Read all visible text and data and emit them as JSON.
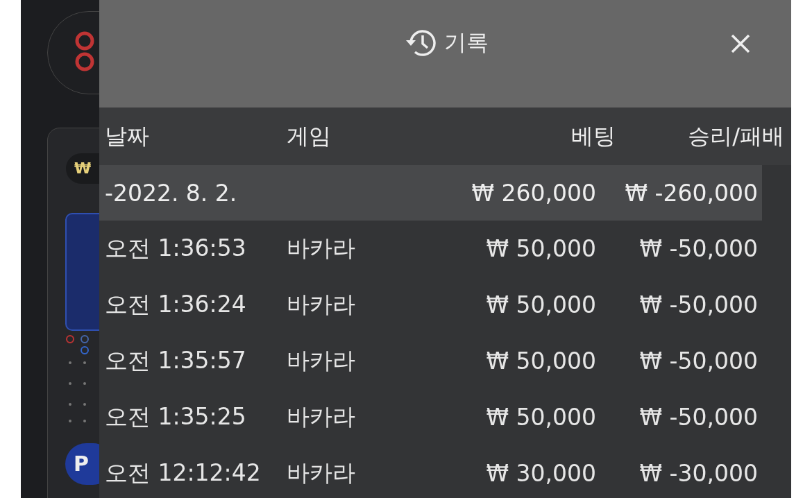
{
  "background_game": {
    "currency_pill": "₩",
    "player_badge": "P"
  },
  "panel": {
    "title": "기록"
  },
  "table": {
    "columns": [
      "날짜",
      "게임",
      "베팅",
      "승리/패배"
    ],
    "groups": [
      {
        "date": "-2022. 8. 2.",
        "bet_total": "₩ 260,000",
        "result_total": "₩ -260,000",
        "rows": [
          {
            "time": "오전 1:36:53",
            "game": "바카라",
            "bet": "₩ 50,000",
            "result": "₩ -50,000"
          },
          {
            "time": "오전 1:36:24",
            "game": "바카라",
            "bet": "₩ 50,000",
            "result": "₩ -50,000"
          },
          {
            "time": "오전 1:35:57",
            "game": "바카라",
            "bet": "₩ 50,000",
            "result": "₩ -50,000"
          },
          {
            "time": "오전 1:35:25",
            "game": "바카라",
            "bet": "₩ 50,000",
            "result": "₩ -50,000"
          },
          {
            "time": "오전 12:12:42",
            "game": "바카라",
            "bet": "₩ 30,000",
            "result": "₩ -30,000"
          }
        ]
      }
    ]
  }
}
